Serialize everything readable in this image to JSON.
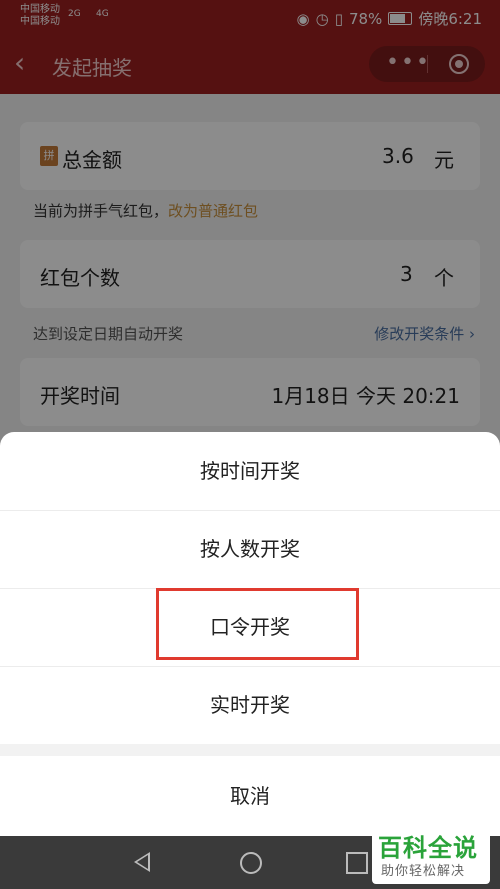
{
  "status_bar": {
    "carrier_1": "中国移动",
    "carrier_2": "中国移动",
    "net_1": "2G",
    "net_2": "4G",
    "battery": "78%",
    "time": "傍晚6:21"
  },
  "nav": {
    "title": "发起抽奖",
    "more_label": "•••"
  },
  "form": {
    "total_amount_label": "总金额",
    "pin_icon_text": "拼",
    "total_amount_value": "3.6",
    "total_amount_unit": "元",
    "current_type_text": "当前为拼手气红包，",
    "switch_link": "改为普通红包",
    "count_label": "红包个数",
    "count_value": "3",
    "count_unit": "个",
    "auto_draw_text": "达到设定日期自动开奖",
    "modify_condition_link": "修改开奖条件",
    "draw_time_label": "开奖时间",
    "draw_time_value": "1月18日 今天 20:21"
  },
  "sheet": {
    "options": [
      "按时间开奖",
      "按人数开奖",
      "口令开奖",
      "实时开奖"
    ],
    "cancel": "取消"
  },
  "watermark": {
    "line1": "百科全说",
    "line2": "助你轻松解决"
  },
  "colors": {
    "header": "#9b1f1f",
    "highlight": "#e03a2f",
    "orange_link": "#c8913d",
    "blue_link": "#4a6ea0"
  }
}
